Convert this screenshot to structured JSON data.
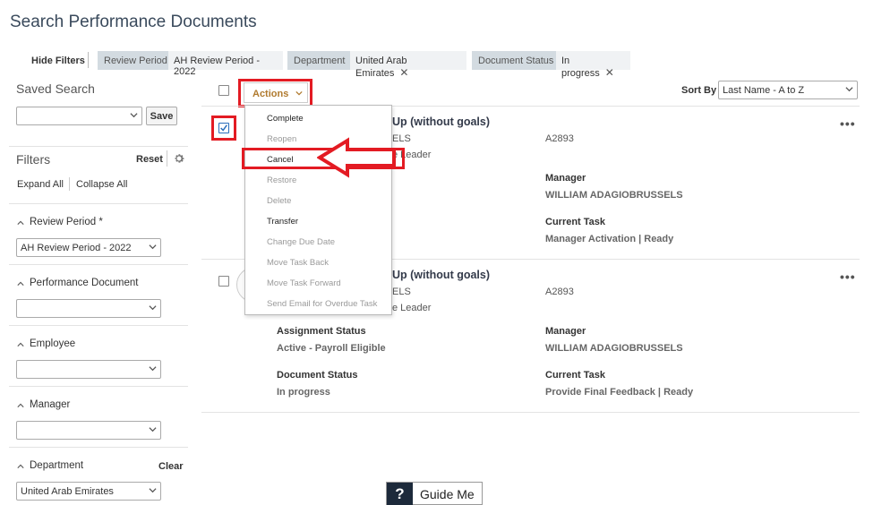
{
  "page_title": "Search Performance Documents",
  "filter_bar": {
    "hide_filters_label": "Hide Filters",
    "chips": [
      {
        "label": "Review Period",
        "value": "AH Review Period - 2022",
        "removable": false
      },
      {
        "label": "Department",
        "value": "United Arab Emirates",
        "removable": true
      },
      {
        "label": "Document Status",
        "value": "In progress",
        "removable": true
      }
    ],
    "remove_glyph": "✕"
  },
  "left_panel": {
    "saved_search_title": "Saved Search",
    "saved_search_value": "",
    "save_button": "Save",
    "filters_title": "Filters",
    "reset_label": "Reset",
    "settings_icon": "gear-icon",
    "expand_all": "Expand All",
    "collapse_all": "Collapse All",
    "sections": [
      {
        "title": "Review Period *",
        "value": "AH Review Period - 2022",
        "clear": ""
      },
      {
        "title": "Performance Document",
        "value": "",
        "clear": ""
      },
      {
        "title": "Employee",
        "value": "",
        "clear": ""
      },
      {
        "title": "Manager",
        "value": "",
        "clear": ""
      },
      {
        "title": "Department",
        "value": "United Arab Emirates",
        "clear": "Clear"
      }
    ]
  },
  "toolbar": {
    "actions_label": "Actions",
    "sort_by_label": "Sort By",
    "sort_value": "Last Name - A to Z"
  },
  "actions_menu": {
    "items": [
      {
        "label": "Complete",
        "enabled": true
      },
      {
        "label": "Reopen",
        "enabled": false
      },
      {
        "label": "Cancel",
        "enabled": true
      },
      {
        "label": "Restore",
        "enabled": false
      },
      {
        "label": "Delete",
        "enabled": false
      },
      {
        "label": "Transfer",
        "enabled": true
      },
      {
        "label": "Change Due Date",
        "enabled": false
      },
      {
        "label": "Move Task Back",
        "enabled": false
      },
      {
        "label": "Move Task Forward",
        "enabled": false
      },
      {
        "label": "Send Email for Overdue Task",
        "enabled": false
      }
    ]
  },
  "documents": [
    {
      "checked": true,
      "title_visible": "Up (without goals)",
      "line2_visible": "ELS",
      "line3_visible": "e Leader",
      "id": "A2893",
      "assignment_status_label": "",
      "assignment_status": "",
      "manager_label": "Manager",
      "manager": "WILLIAM ADAGIOBRUSSELS",
      "document_status_label": "",
      "document_status": "",
      "current_task_label": "Current Task",
      "current_task": "Manager Activation | Ready"
    },
    {
      "checked": false,
      "title_visible": "Up (without goals)",
      "line2_visible": "ELS",
      "line3_visible": "e Leader",
      "id": "A2893",
      "assignment_status_label": "Assignment Status",
      "assignment_status": "Active - Payroll Eligible",
      "manager_label": "Manager",
      "manager": "WILLIAM ADAGIOBRUSSELS",
      "document_status_label": "Document Status",
      "document_status": "In progress",
      "current_task_label": "Current Task",
      "current_task": "Provide Final Feedback | Ready"
    }
  ],
  "more_glyph": "•••",
  "guide_me": {
    "icon": "?",
    "label": "Guide Me"
  },
  "colors": {
    "accent_actions": "#b07a2e",
    "annotation_red": "#e31b23",
    "chip_label_bg": "#d3dbe1",
    "check_blue": "#2a6ebb"
  }
}
